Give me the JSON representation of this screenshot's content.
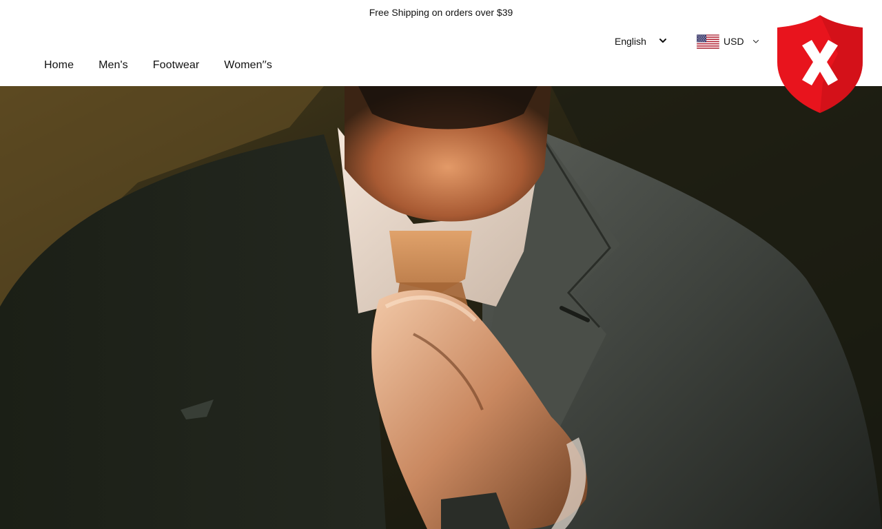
{
  "announcement": {
    "text": "Free Shipping on orders over $39"
  },
  "nav": {
    "items": [
      {
        "label": "Home"
      },
      {
        "label": "Men's"
      },
      {
        "label": "Footwear"
      },
      {
        "label": "Women′′s"
      }
    ]
  },
  "language": {
    "selected": "English",
    "icon": "chevron-down-icon"
  },
  "currency": {
    "selected": "USD",
    "flag_icon": "us-flag-icon",
    "chevron_icon": "chevron-down-icon"
  },
  "hero": {
    "image": "man-adjusting-tie-photo"
  },
  "overlay": {
    "icon": "red-shield-x-icon",
    "colors": {
      "shield": "#e8141d",
      "shadow": "#b80c14",
      "mark": "#ffffff"
    }
  }
}
